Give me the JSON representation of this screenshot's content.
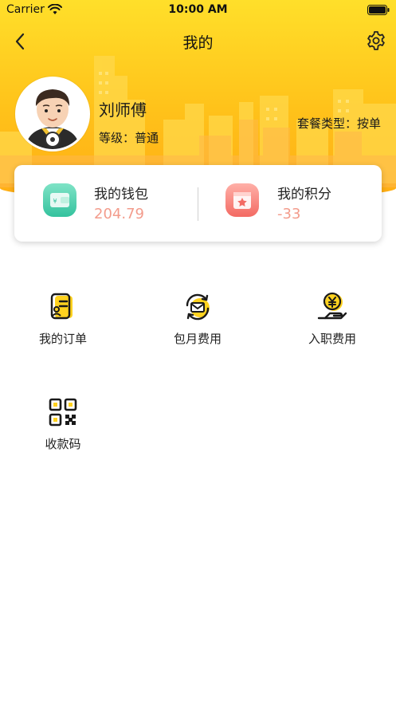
{
  "status_bar": {
    "carrier": "Carrier",
    "time": "10:00 AM"
  },
  "nav": {
    "title": "我的",
    "back_icon": "chevron-left-icon",
    "settings_icon": "gear-icon"
  },
  "profile": {
    "name": "刘师傅",
    "level": "等级：普通",
    "plan_type": "套餐类型：按单",
    "avatar_icon": "driver-avatar-icon"
  },
  "wallet": {
    "balance_label": "我的钱包",
    "balance_value": "204.79",
    "points_label": "我的积分",
    "points_value": "-33",
    "value_color": "#f39c8c"
  },
  "menu": {
    "items": [
      {
        "label": "我的订单",
        "icon": "order-list-icon"
      },
      {
        "label": "包月费用",
        "icon": "monthly-fee-icon"
      },
      {
        "label": "入职费用",
        "icon": "onboarding-fee-icon"
      },
      {
        "label": "收款码",
        "icon": "qr-code-icon"
      }
    ]
  },
  "colors": {
    "brand_yellow": "#ffc21a",
    "icon_black": "#1a1a1a",
    "icon_yellow": "#ffd21f"
  }
}
